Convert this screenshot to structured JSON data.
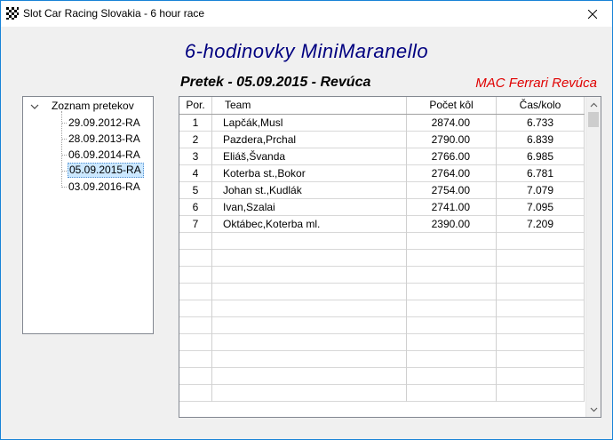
{
  "window": {
    "title": "Slot Car Racing Slovakia - 6 hour race"
  },
  "header": {
    "main_title": "6-hodinovky MiniMaranello",
    "race_title": "Pretek - 05.09.2015 - Revúca",
    "club_name": "MAC Ferrari Revúca"
  },
  "tree": {
    "root_label": "Zoznam pretekov",
    "items": [
      {
        "label": "29.09.2012-RA"
      },
      {
        "label": "28.09.2013-RA"
      },
      {
        "label": "06.09.2014-RA"
      },
      {
        "label": "05.09.2015-RA",
        "selected": true
      },
      {
        "label": "03.09.2016-RA"
      }
    ]
  },
  "table": {
    "columns": [
      "Por.",
      "Team",
      "Počet kôl",
      "Čas/kolo"
    ],
    "rows": [
      {
        "por": "1",
        "team": "Lapčák,Musl",
        "pocet": "2874.00",
        "cas": "6.733"
      },
      {
        "por": "2",
        "team": "Pazdera,Prchal",
        "pocet": "2790.00",
        "cas": "6.839"
      },
      {
        "por": "3",
        "team": "Eliáš,Švanda",
        "pocet": "2766.00",
        "cas": "6.985"
      },
      {
        "por": "4",
        "team": "Koterba st.,Bokor",
        "pocet": "2764.00",
        "cas": "6.781"
      },
      {
        "por": "5",
        "team": "Johan st.,Kudlák",
        "pocet": "2754.00",
        "cas": "7.079"
      },
      {
        "por": "6",
        "team": "Ivan,Szalai",
        "pocet": "2741.00",
        "cas": "7.095"
      },
      {
        "por": "7",
        "team": "Oktábec,Koterba ml.",
        "pocet": "2390.00",
        "cas": "7.209"
      }
    ],
    "empty_rows": 10
  },
  "colors": {
    "title_blue": "#000080",
    "club_red": "#e00000",
    "selection": "#cce8ff"
  },
  "icons": {
    "app": "checkered-flag-icon",
    "close": "close-icon",
    "tree_expand": "chevron-down-icon",
    "scroll_up": "chevron-up-icon",
    "scroll_down": "chevron-down-icon"
  }
}
